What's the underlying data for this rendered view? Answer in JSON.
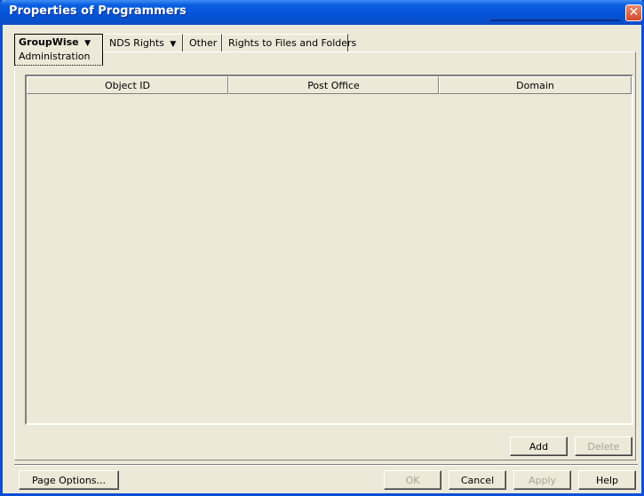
{
  "window": {
    "title": "Properties of Programmers",
    "close_glyph": "✕"
  },
  "tabs": [
    {
      "label": "GroupWise",
      "dropdown": true,
      "active": true,
      "sub_tab": "Administration"
    },
    {
      "label": "NDS Rights",
      "dropdown": true
    },
    {
      "label": "Other"
    },
    {
      "label": "Rights to Files and Folders"
    }
  ],
  "dropdown_glyph": "▼",
  "table": {
    "columns": [
      "Object ID",
      "Post Office",
      "Domain"
    ],
    "rows": []
  },
  "list_buttons": {
    "add": "Add",
    "delete": "Delete"
  },
  "footer_buttons": {
    "page_options": "Page Options...",
    "ok": "OK",
    "cancel": "Cancel",
    "apply": "Apply",
    "help": "Help"
  },
  "colors": {
    "titlebar": "#0353d6",
    "dialog_bg": "#ece9d8",
    "close_button": "#d5482a"
  },
  "icons": [
    "close-icon",
    "dropdown-arrow-icon"
  ]
}
